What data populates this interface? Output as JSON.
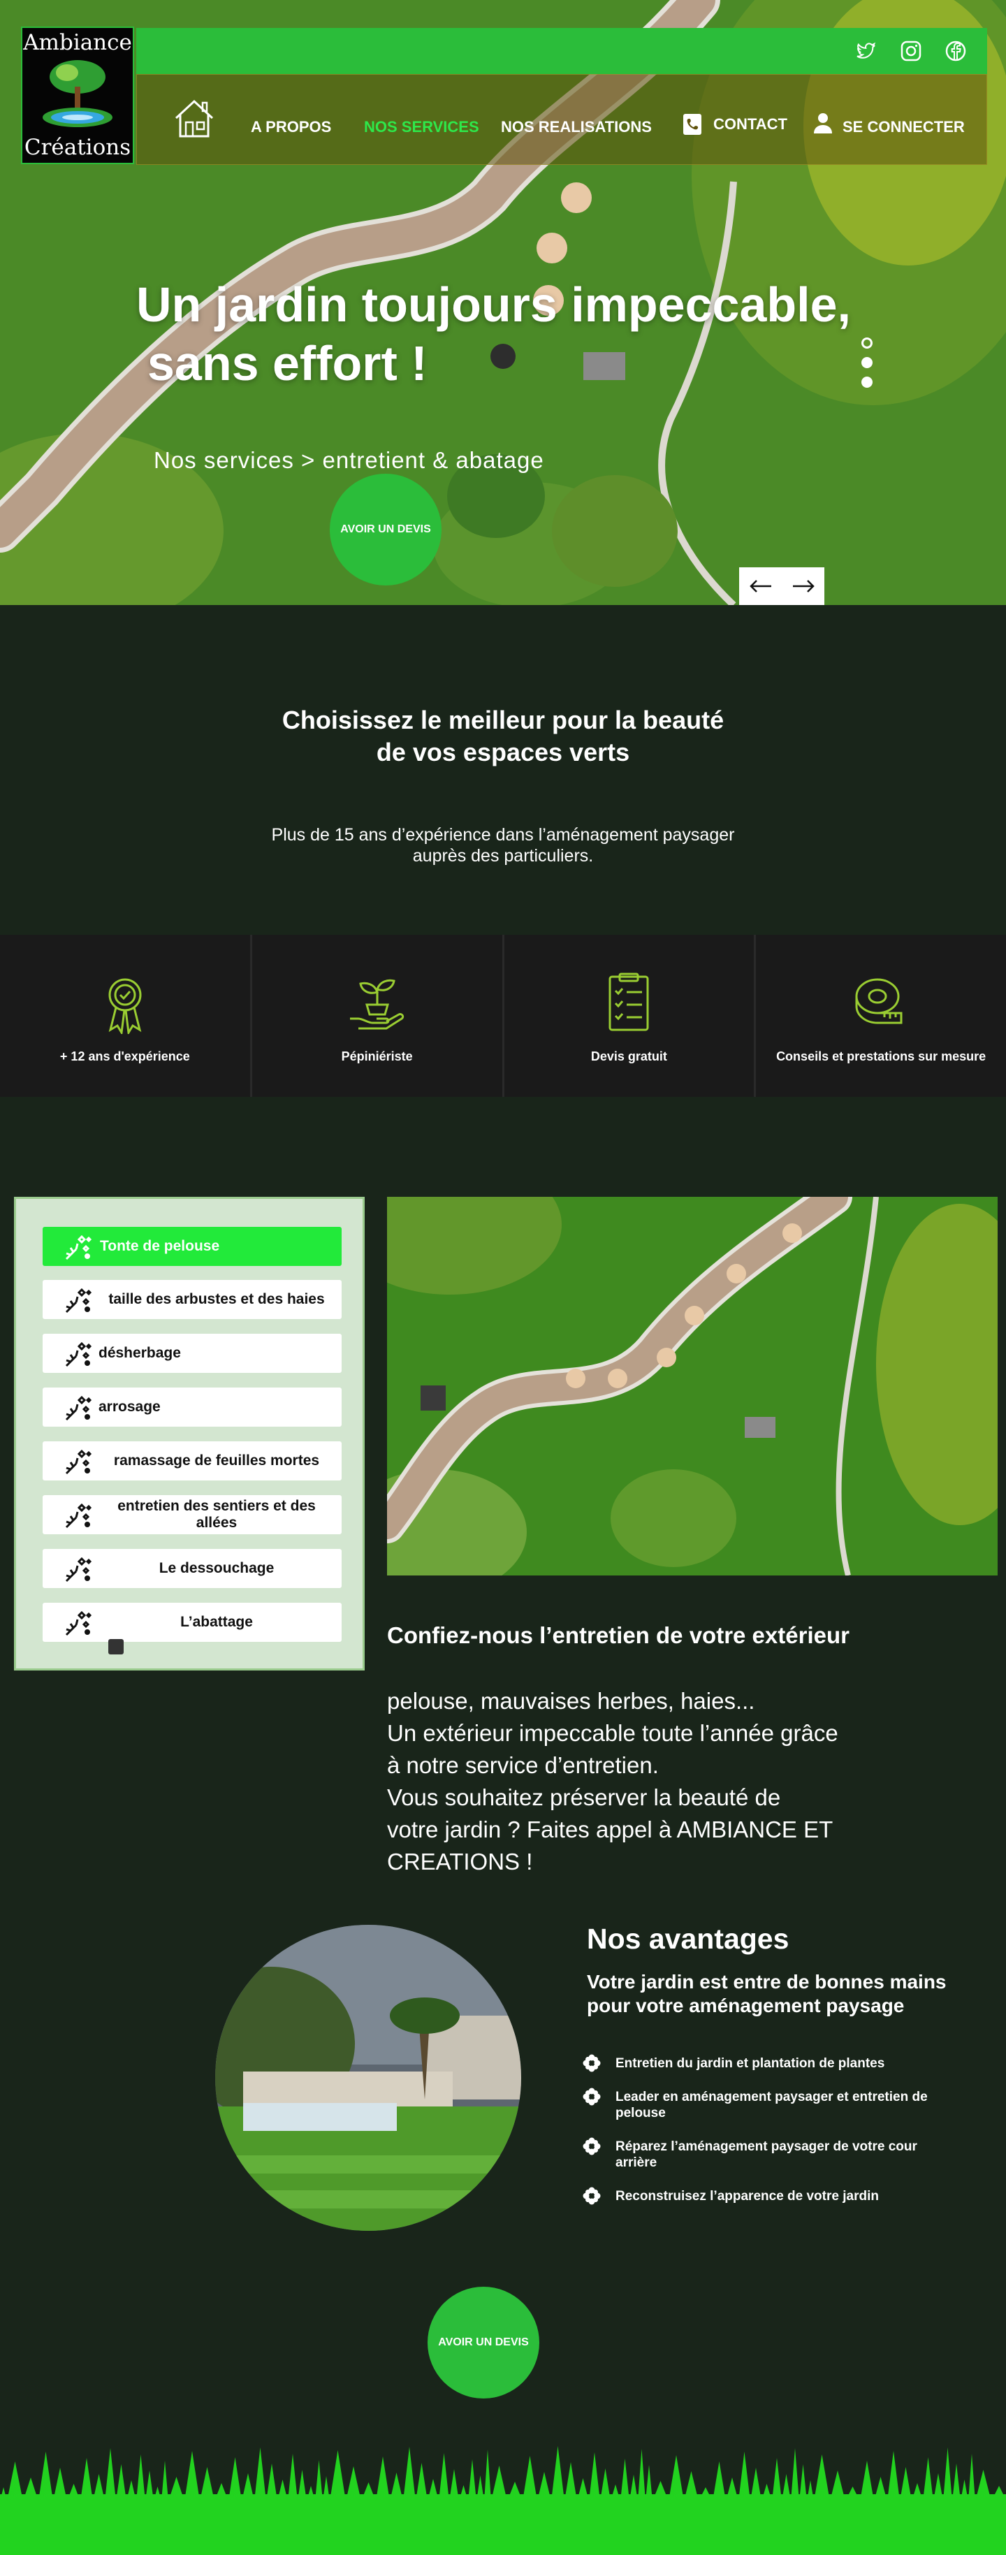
{
  "brand": {
    "line1": "Ambiance",
    "line2": "Créations"
  },
  "social": [
    "twitter-icon",
    "instagram-icon",
    "facebook-icon"
  ],
  "nav": {
    "about": "A PROPOS",
    "services": "NOS SERVICES",
    "realisations": "NOS REALISATIONS",
    "contact": "CONTACT",
    "login": "SE CONNECTER"
  },
  "hero": {
    "title_line1": "Un jardin toujours impeccable,",
    "title_line2": "sans effort !",
    "subtitle": "Nos services > entretient & abatage",
    "cta": "AVOIR UN DEVIS",
    "slides_total": 3,
    "slide_active": 1
  },
  "intro": {
    "title_line1": "Choisissez le meilleur pour la beauté",
    "title_line2": "de vos espaces verts",
    "text_line1": "Plus de 15 ans d’expérience dans l’aménagement paysager",
    "text_line2": "auprès des particuliers."
  },
  "features": [
    {
      "icon": "award-ribbon-icon",
      "label": "+ 12 ans d'expérience"
    },
    {
      "icon": "seedling-hand-icon",
      "label": "Pépiniériste"
    },
    {
      "icon": "checklist-icon",
      "label": "Devis gratuit"
    },
    {
      "icon": "measuring-tape-icon",
      "label": "Conseils et prestations sur mesure"
    }
  ],
  "services": {
    "items": [
      "Tonte de pelouse",
      "taille des arbustes et des haies",
      "désherbage",
      "arrosage",
      "ramassage de feuilles mortes",
      "entretien des sentiers et des allées",
      "Le dessouchage",
      "L’abattage"
    ],
    "active_index": 0,
    "title": "Confiez-nous l’entretien de votre extérieur",
    "text": [
      "pelouse, mauvaises herbes, haies...",
      "Un extérieur impeccable toute l’année grâce",
      "à notre service d’entretien.",
      "Vous souhaitez préserver la beauté de",
      "votre jardin ? Faites appel à AMBIANCE ET",
      "CREATIONS !"
    ]
  },
  "avantages": {
    "title": "Nos avantages",
    "subtitle": "Votre jardin est entre de bonnes mains pour votre aménagement paysage",
    "items": [
      "Entretien du jardin et plantation de plantes",
      "Leader en aménagement paysager et entretien de pelouse",
      "Réparez l’aménagement paysager de votre cour arrière",
      "Reconstruisez l’apparence de votre jardin"
    ],
    "cta": "AVOIR UN DEVIS"
  },
  "colors": {
    "accent": "#2bbd3a",
    "bright_green": "#22ea3a",
    "background": "#19251a",
    "icon_lime": "#9acd32"
  }
}
